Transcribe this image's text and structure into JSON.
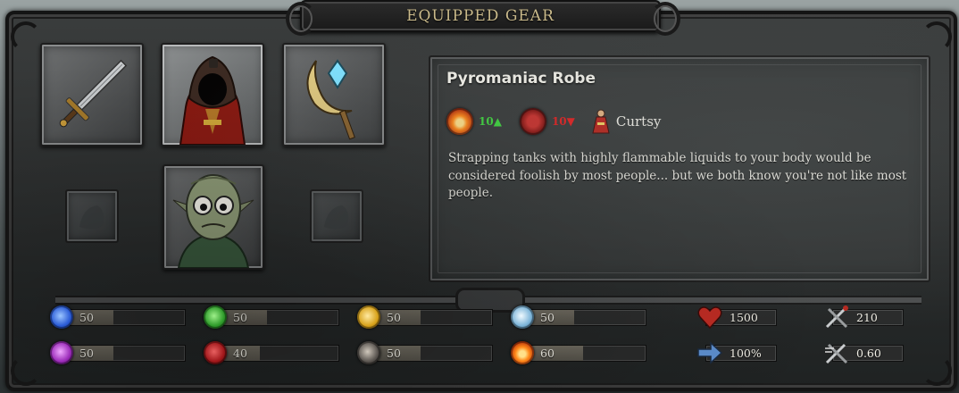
{
  "title": "EQUIPPED GEAR",
  "item": {
    "name": "Pyromaniac Robe",
    "fire_bonus": "10",
    "blood_penalty": "10",
    "skill": "Curtsy",
    "description": "Strapping tanks with highly flammable liquids to your body would be considered foolish by most people... but we both know you're not like most people."
  },
  "slots": [
    {
      "name": "weapon-slot",
      "icon": "sword-icon"
    },
    {
      "name": "armor-slot",
      "icon": "hooded-robe-icon",
      "selected": true
    },
    {
      "name": "trinket-slot",
      "icon": "crescent-staff-icon"
    },
    {
      "name": "empty-left-slot",
      "icon": "empty-slot-icon"
    },
    {
      "name": "character-portrait",
      "icon": "character-face-icon"
    },
    {
      "name": "empty-right-slot",
      "icon": "empty-slot-icon"
    }
  ],
  "stats": [
    {
      "name": "frost-stat",
      "icon": "frost-orb-icon",
      "value": "50",
      "fill": 0.25,
      "color": "#2a5bd6"
    },
    {
      "name": "nature-stat",
      "icon": "nature-orb-icon",
      "value": "50",
      "fill": 0.25,
      "color": "#2e9b2a"
    },
    {
      "name": "defense-stat",
      "icon": "shield-orb-icon",
      "value": "50",
      "fill": 0.25,
      "color": "#d8a21a"
    },
    {
      "name": "ice-stat",
      "icon": "ice-orb-icon",
      "value": "50",
      "fill": 0.25,
      "color": "#7cb4d8"
    },
    {
      "name": "arcane-stat",
      "icon": "arcane-orb-icon",
      "value": "50",
      "fill": 0.25,
      "color": "#9a2ab8"
    },
    {
      "name": "blood-stat",
      "icon": "blood-orb-icon",
      "value": "40",
      "fill": 0.2,
      "color": "#a0171a"
    },
    {
      "name": "armor-stat",
      "icon": "armor-orb-icon",
      "value": "50",
      "fill": 0.25,
      "color": "#5a5550"
    },
    {
      "name": "fire-stat",
      "icon": "fire-orb-icon",
      "value": "60",
      "fill": 0.3,
      "color": "#e2651a"
    }
  ],
  "resources": {
    "health": "1500",
    "speed": "100%",
    "attack": "210",
    "attack_speed": "0.60"
  },
  "colors": {
    "title_gold": "#c9b98a",
    "up_green": "#3fd43f",
    "down_red": "#e02020"
  }
}
